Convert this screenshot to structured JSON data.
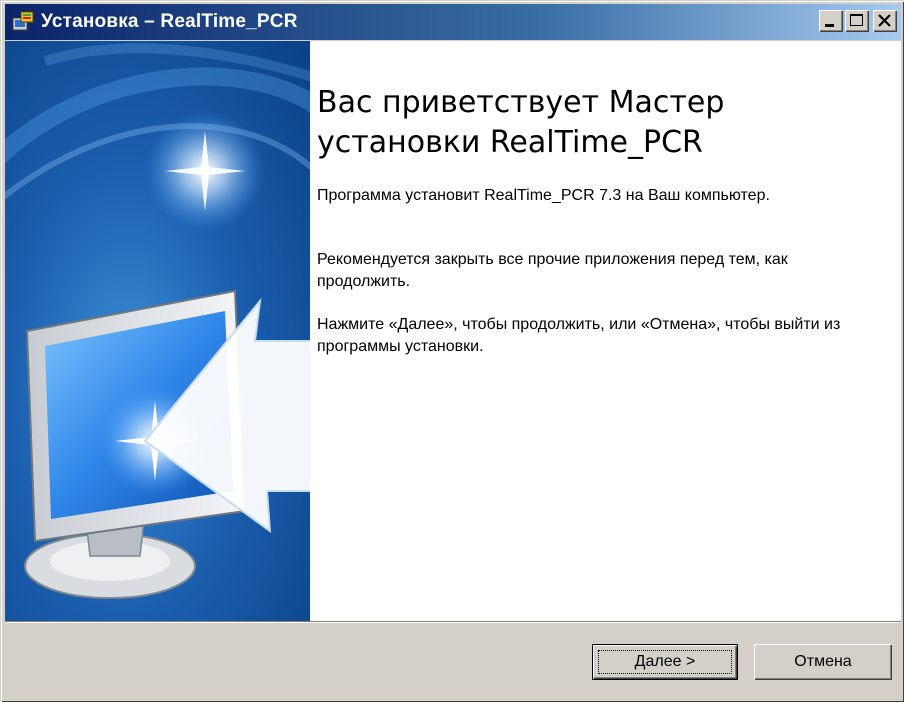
{
  "window": {
    "title": "Установка – RealTime_PCR",
    "icon": "installer-icon",
    "controls": [
      "minimize-icon",
      "maximize-icon",
      "close-icon"
    ]
  },
  "banner": {
    "image": "computer-monitor-arrow-illustration"
  },
  "content": {
    "heading": "Вас приветствует Мастер установки RealTime_PCR",
    "paragraph1": "Программа установит RealTime_PCR 7.3 на Ваш компьютер.",
    "paragraph2": "Рекомендуется закрыть все прочие приложения перед тем, как продолжить.",
    "paragraph3": "Нажмите «Далее», чтобы продолжить, или «Отмена», чтобы выйти из программы установки."
  },
  "buttons": {
    "next_label": "Далее >",
    "cancel_label": "Отмена"
  },
  "colors": {
    "titlebar_start": "#0a246a",
    "titlebar_end": "#a6caf0",
    "dialog_face": "#d4d0c8",
    "banner_blue": "#1b5fae"
  }
}
